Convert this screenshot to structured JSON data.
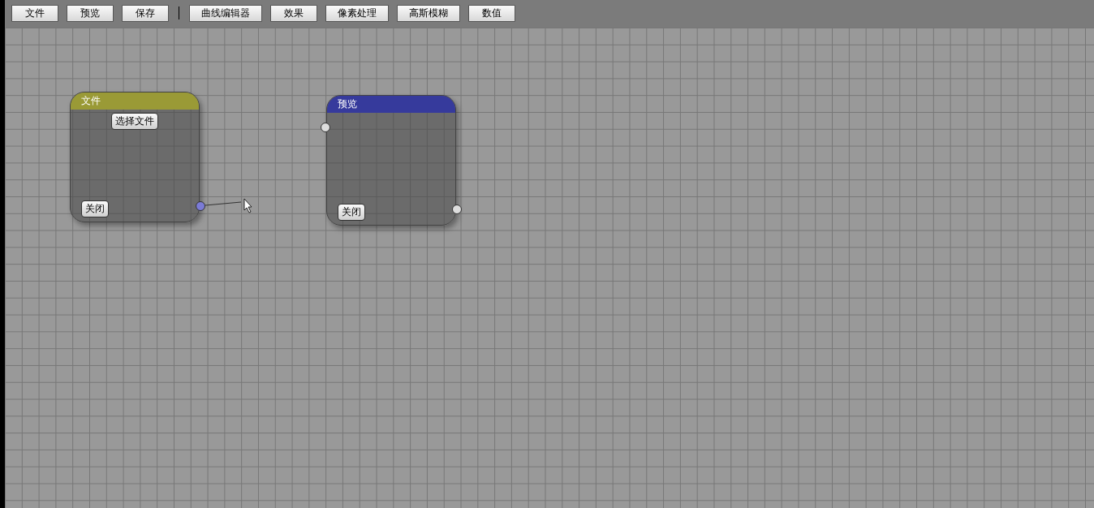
{
  "toolbar": {
    "groups": [
      {
        "buttons": [
          "文件",
          "预览",
          "保存"
        ]
      },
      {
        "buttons": [
          "曲线编辑器",
          "效果",
          "像素处理",
          "高斯模糊",
          "数值"
        ]
      }
    ]
  },
  "canvas": {
    "nodes": [
      {
        "title": "文件",
        "color": "#9a9a36",
        "buttons": [
          {
            "kind": "top",
            "label": "选择文件"
          },
          {
            "kind": "bottom",
            "label": "关闭"
          }
        ],
        "ports": [
          {
            "kind": "output",
            "active": true
          }
        ],
        "dragging_link": true
      },
      {
        "title": "预览",
        "color": "#363a9c",
        "buttons": [
          {
            "kind": "bottom",
            "label": "关闭"
          }
        ],
        "ports": [
          {
            "kind": "input",
            "active": false
          },
          {
            "kind": "output",
            "active": false
          }
        ]
      }
    ]
  }
}
